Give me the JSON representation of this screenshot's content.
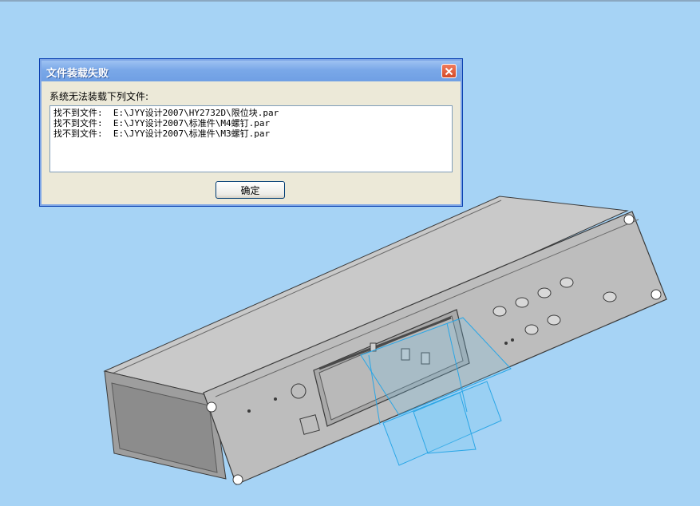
{
  "dialog": {
    "title": "文件装载失败",
    "message": "系统无法装载下列文件:",
    "missing_files": [
      "找不到文件:  E:\\JYY设计2007\\HY2732D\\限位块.par",
      "找不到文件:  E:\\JYY设计2007\\标准件\\M4螺钉.par",
      "找不到文件:  E:\\JYY设计2007\\标准件\\M3螺钉.par"
    ],
    "ok_label": "确定",
    "close_icon": "close-icon"
  },
  "colors": {
    "viewport_background": "#a6d3f5",
    "model_body": "#b4b4b4",
    "model_edges": "#3a3a3a",
    "sketch_lines": "#2aa6e6"
  }
}
